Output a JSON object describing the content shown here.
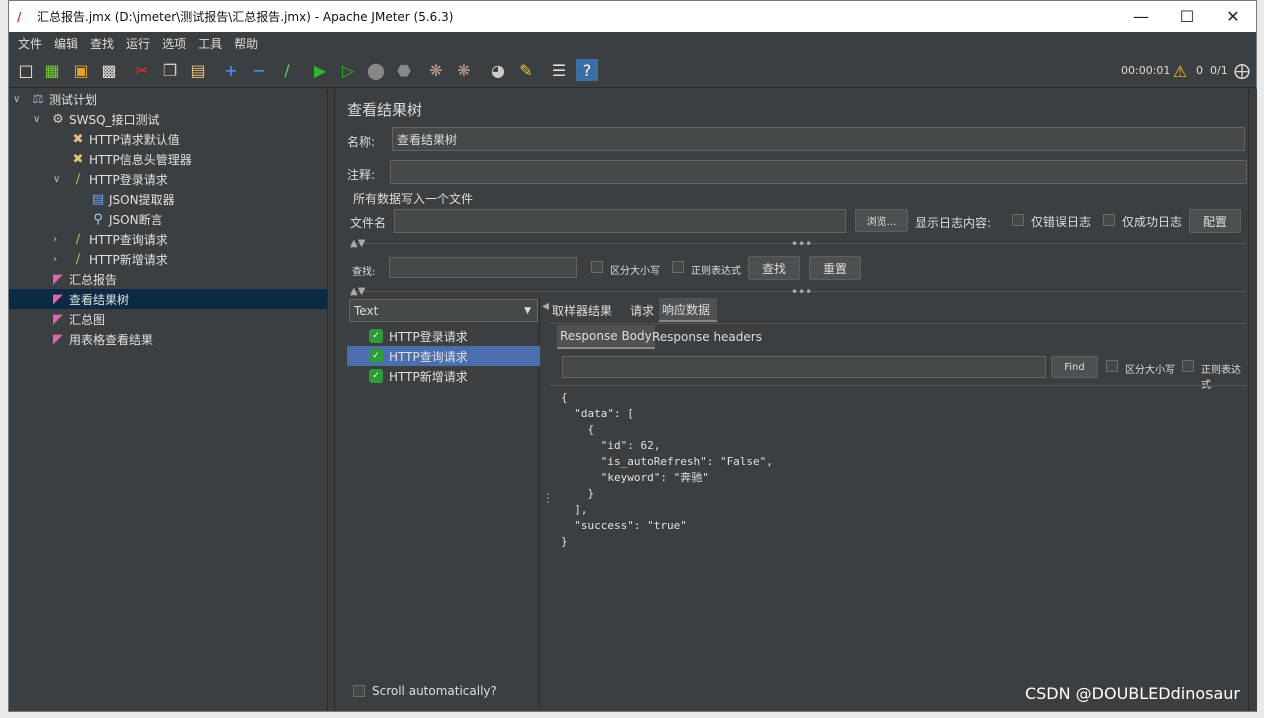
{
  "window": {
    "title": "汇总报告.jmx (D:\\jmeter\\测试报告\\汇总报告.jmx) - Apache JMeter (5.6.3)"
  },
  "menu": [
    "文件",
    "编辑",
    "查找",
    "运行",
    "选项",
    "工具",
    "帮助"
  ],
  "status": {
    "timer": "00:00:01",
    "warnings": "0",
    "threads": "0/1"
  },
  "tree": {
    "plan": "测试计划",
    "group": "SWSQ_接口测试",
    "defaults": "HTTP请求默认值",
    "headers": "HTTP信息头管理器",
    "login": "HTTP登录请求",
    "json_extract": "JSON提取器",
    "json_assert": "JSON断言",
    "query": "HTTP查询请求",
    "add": "HTTP新增请求",
    "summary": "汇总报告",
    "results_tree": "查看结果树",
    "graph": "汇总图",
    "table": "用表格查看结果"
  },
  "panel": {
    "title": "查看结果树",
    "name_label": "名称:",
    "name_value": "查看结果树",
    "comment_label": "注释:",
    "comment_value": "",
    "file_group": "所有数据写入一个文件",
    "filename_label": "文件名",
    "browse": "浏览...",
    "log_label": "显示日志内容:",
    "errors_only": "仅错误日志",
    "success_only": "仅成功日志",
    "configure": "配置",
    "search_label": "查找:",
    "case_sensitive": "区分大小写",
    "regex": "正则表达式",
    "search_btn": "查找",
    "reset_btn": "重置",
    "renderer": "Text",
    "samples": [
      "HTTP登录请求",
      "HTTP查询请求",
      "HTTP新增请求"
    ],
    "tabs": [
      "取样器结果",
      "请求",
      "响应数据"
    ],
    "subtabs": [
      "Response Body",
      "Response headers"
    ],
    "find_btn": "Find",
    "find_case": "区分大小写",
    "find_regex": "正则表达式",
    "response": "{\n  \"data\": [\n    {\n      \"id\": 62,\n      \"is_autoRefresh\": \"False\",\n      \"keyword\": \"奔驰\"\n    }\n  ],\n  \"success\": \"true\"\n}",
    "scroll_auto": "Scroll automatically?"
  },
  "watermark": "CSDN @DOUBLEDdinosaur"
}
